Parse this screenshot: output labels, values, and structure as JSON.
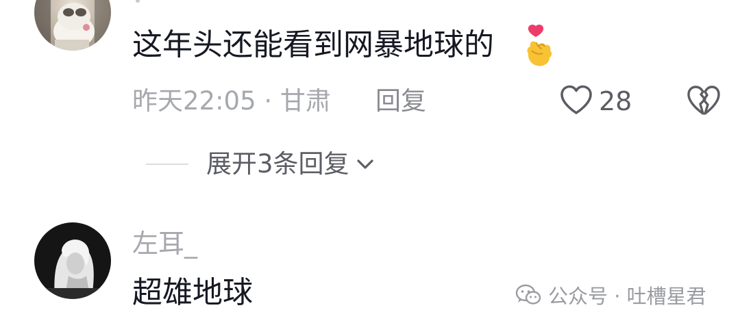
{
  "comments": [
    {
      "text": "这年头还能看到网暴地球的",
      "emoji": "finger-heart-emoji",
      "meta": "昨天22:05 · 甘肃",
      "reply_label": "回复",
      "like_count": "28",
      "expand_label": "展开3条回复"
    },
    {
      "username": "左耳_",
      "text": "超雄地球"
    }
  ],
  "watermark": {
    "text": "公众号 · 吐槽星君",
    "icon": "wechat-icon"
  },
  "colors": {
    "primary_text": "#161823",
    "secondary_text": "#a6a8ae",
    "icon_gray": "#5c5d63"
  }
}
